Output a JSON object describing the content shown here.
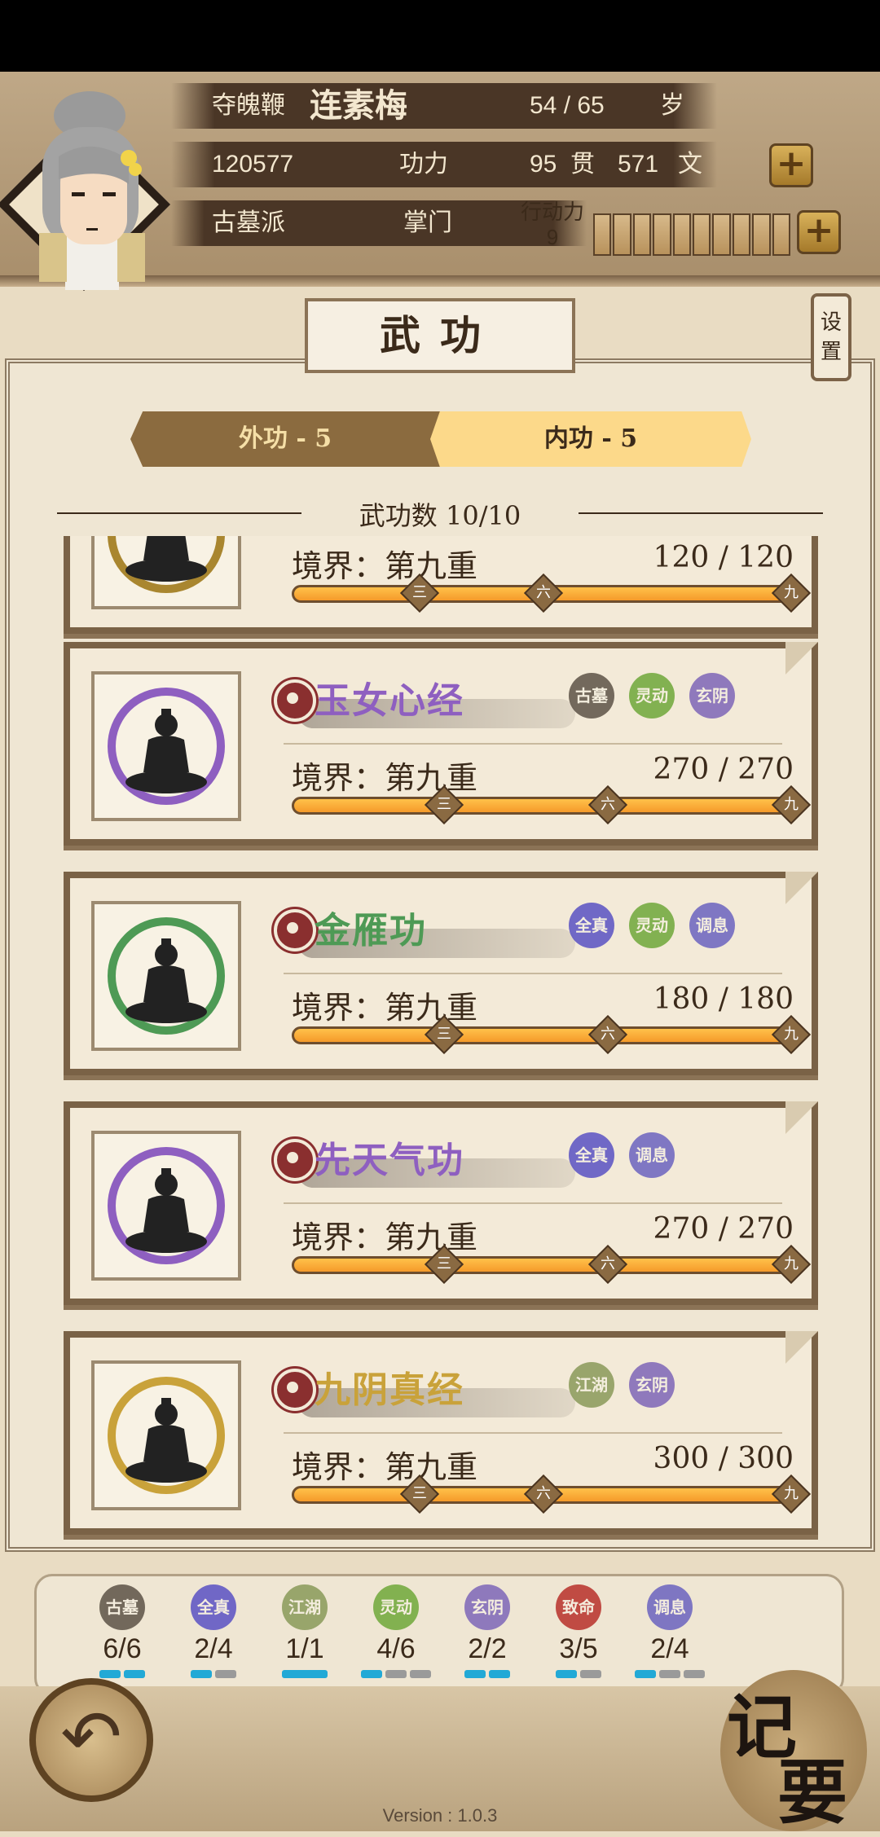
{
  "header": {
    "title_label": "夺魄鞭",
    "name": "连素梅",
    "age": "54 / 65",
    "age_unit": "岁",
    "power_value": "120577",
    "power_label": "功力",
    "money_guan": "95",
    "money_guan_unit": "贯",
    "money_wen": "571",
    "money_wen_unit": "文",
    "sect": "古墓派",
    "rank": "掌门",
    "stamina_label": "行动力",
    "stamina_value": "9",
    "add_symbol": "+"
  },
  "page_title": "武功",
  "settings_label": "设置",
  "tabs": [
    {
      "label": "外功 - 5",
      "active": false
    },
    {
      "label": "内功 - 5",
      "active": true
    }
  ],
  "count_text": "武功数 10/10",
  "marks": [
    "三",
    "六",
    "九"
  ],
  "skills": [
    {
      "name": "",
      "realm": "境界：第九重",
      "progress": "120 / 120",
      "progress_fraction": 1.0,
      "color": "#a9862f",
      "tags": []
    },
    {
      "name": "玉女心经",
      "realm": "境界：第九重",
      "progress": "270 / 270",
      "progress_fraction": 1.0,
      "color": "#8e5fc0",
      "tags": [
        {
          "text": "古墓",
          "color": "#5d5347"
        },
        {
          "text": "灵动",
          "color": "#6fa83a"
        },
        {
          "text": "玄阴",
          "color": "#7e66b8"
        }
      ]
    },
    {
      "name": "金雁功",
      "realm": "境界：第九重",
      "progress": "180 / 180",
      "progress_fraction": 1.0,
      "color": "#4e9a55",
      "tags": [
        {
          "text": "全真",
          "color": "#5a52c4"
        },
        {
          "text": "灵动",
          "color": "#6fa83a"
        },
        {
          "text": "调息",
          "color": "#6b63c0"
        }
      ]
    },
    {
      "name": "先天气功",
      "realm": "境界：第九重",
      "progress": "270 / 270",
      "progress_fraction": 1.0,
      "color": "#8e5fc0",
      "tags": [
        {
          "text": "全真",
          "color": "#5a52c4"
        },
        {
          "text": "调息",
          "color": "#6b63c0"
        }
      ]
    },
    {
      "name": "九阴真经",
      "realm": "境界：第九重",
      "progress": "300 / 300",
      "progress_fraction": 1.0,
      "color": "#c9a23a",
      "tags": [
        {
          "text": "江湖",
          "color": "#8a9a5a"
        },
        {
          "text": "玄阴",
          "color": "#7e66b8"
        }
      ]
    }
  ],
  "summary": [
    {
      "tag": "古墓",
      "color": "#5d5347",
      "count": "6/6",
      "filled": 2,
      "total": 2
    },
    {
      "tag": "全真",
      "color": "#5a52c4",
      "count": "2/4",
      "filled": 1,
      "total": 2
    },
    {
      "tag": "江湖",
      "color": "#8a9a5a",
      "count": "1/1",
      "filled": 1,
      "total": 1
    },
    {
      "tag": "灵动",
      "color": "#6fa83a",
      "count": "4/6",
      "filled": 1,
      "total": 3
    },
    {
      "tag": "玄阴",
      "color": "#7e66b8",
      "count": "2/2",
      "filled": 2,
      "total": 2
    },
    {
      "tag": "致命",
      "color": "#b8302a",
      "count": "3/5",
      "filled": 1,
      "total": 2
    },
    {
      "tag": "调息",
      "color": "#6b63c0",
      "count": "2/4",
      "filled": 1,
      "total": 3
    }
  ],
  "back_symbol": "↶",
  "memo_chars": [
    "记",
    "要"
  ],
  "version": "Version : 1.0.3",
  "colors": {
    "pip_on": "#22a9d6",
    "pip_off": "#9a9a9a",
    "accent": "#7a6246"
  }
}
